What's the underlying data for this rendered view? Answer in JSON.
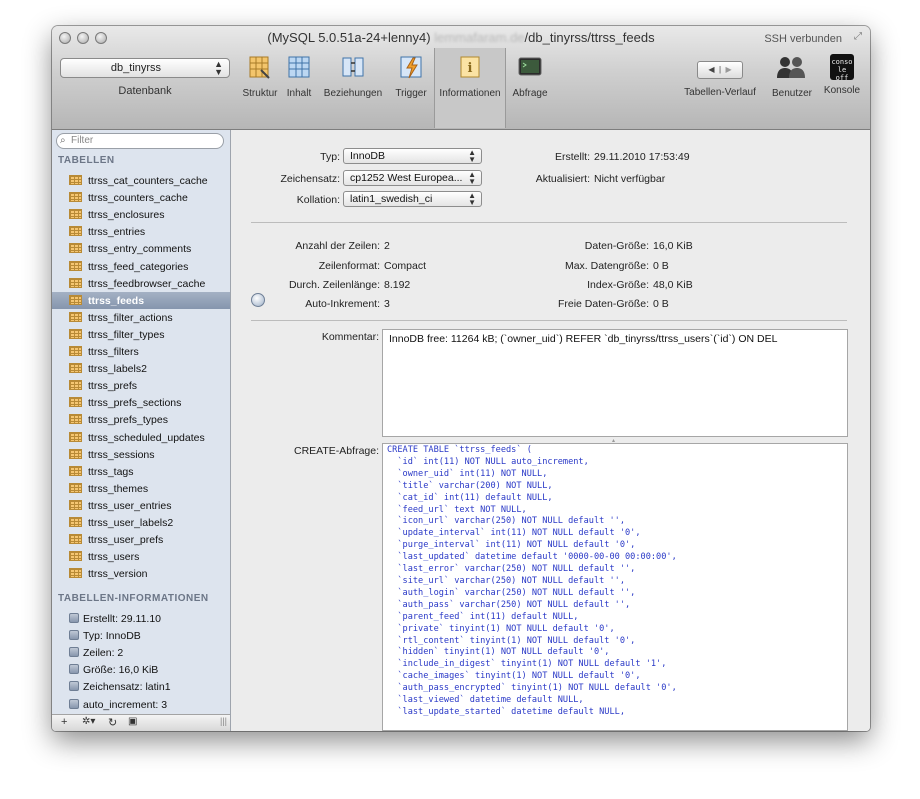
{
  "window": {
    "title_prefix": "(MySQL 5.0.51a-24+lenny4)",
    "title_blurred": "lemmafaram.de",
    "title_suffix": "/db_tinyrss/ttrss_feeds",
    "ssh_status": "SSH verbunden"
  },
  "toolbar": {
    "database_value": "db_tinyrss",
    "database_label": "Datenbank",
    "tools": [
      {
        "label": "Struktur",
        "icon": "structure-icon"
      },
      {
        "label": "Inhalt",
        "icon": "content-icon"
      },
      {
        "label": "Beziehungen",
        "icon": "relations-icon"
      },
      {
        "label": "Trigger",
        "icon": "trigger-icon"
      },
      {
        "label": "Informationen",
        "icon": "info-icon",
        "active": true
      },
      {
        "label": "Abfrage",
        "icon": "query-icon"
      }
    ],
    "history_label": "Tabellen-Verlauf",
    "users_label": "Benutzer",
    "console_label": "Konsole",
    "console_icon_text": "conso le off"
  },
  "sidebar": {
    "filter_placeholder": "Filter",
    "tables_heading": "TABELLEN",
    "tables": [
      "ttrss_cat_counters_cache",
      "ttrss_counters_cache",
      "ttrss_enclosures",
      "ttrss_entries",
      "ttrss_entry_comments",
      "ttrss_feed_categories",
      "ttrss_feedbrowser_cache",
      "ttrss_feeds",
      "ttrss_filter_actions",
      "ttrss_filter_types",
      "ttrss_filters",
      "ttrss_labels2",
      "ttrss_prefs",
      "ttrss_prefs_sections",
      "ttrss_prefs_types",
      "ttrss_scheduled_updates",
      "ttrss_sessions",
      "ttrss_tags",
      "ttrss_themes",
      "ttrss_user_entries",
      "ttrss_user_labels2",
      "ttrss_user_prefs",
      "ttrss_users",
      "ttrss_version"
    ],
    "selected_table": "ttrss_feeds",
    "info_heading": "TABELLEN-INFORMATIONEN",
    "info_items": [
      "Erstellt: 29.11.10",
      "Typ: InnoDB",
      "Zeilen: 2",
      "Größe: 16,0 KiB",
      "Zeichensatz: latin1",
      "auto_increment: 3"
    ]
  },
  "info": {
    "type_label": "Typ:",
    "type_value": "InnoDB",
    "charset_label": "Zeichensatz:",
    "charset_value": "cp1252 West Europea...",
    "collation_label": "Kollation:",
    "collation_value": "latin1_swedish_ci",
    "created_label": "Erstellt:",
    "created_value": "29.11.2010 17:53:49",
    "updated_label": "Aktualisiert:",
    "updated_value": "Nicht verfügbar",
    "rows_label": "Anzahl der Zeilen:",
    "rows_value": "2",
    "format_label": "Zeilenformat:",
    "format_value": "Compact",
    "avglen_label": "Durch. Zeilenlänge:",
    "avglen_value": "8.192",
    "autoinc_label": "Auto-Inkrement:",
    "autoinc_value": "3",
    "datasize_label": "Daten-Größe:",
    "datasize_value": "16,0 KiB",
    "maxdata_label": "Max. Datengröße:",
    "maxdata_value": "0 B",
    "indexsize_label": "Index-Größe:",
    "indexsize_value": "48,0 KiB",
    "free_label": "Freie Daten-Größe:",
    "free_value": "0 B",
    "comment_label": "Kommentar:",
    "comment_value": "InnoDB free: 11264 kB; (`owner_uid`) REFER `db_tinyrss/ttrss_users`(`id`) ON DEL",
    "create_label": "CREATE-Abfrage:",
    "create_sql": "CREATE TABLE `ttrss_feeds` (\n  `id` int(11) NOT NULL auto_increment,\n  `owner_uid` int(11) NOT NULL,\n  `title` varchar(200) NOT NULL,\n  `cat_id` int(11) default NULL,\n  `feed_url` text NOT NULL,\n  `icon_url` varchar(250) NOT NULL default '',\n  `update_interval` int(11) NOT NULL default '0',\n  `purge_interval` int(11) NOT NULL default '0',\n  `last_updated` datetime default '0000-00-00 00:00:00',\n  `last_error` varchar(250) NOT NULL default '',\n  `site_url` varchar(250) NOT NULL default '',\n  `auth_login` varchar(250) NOT NULL default '',\n  `auth_pass` varchar(250) NOT NULL default '',\n  `parent_feed` int(11) default NULL,\n  `private` tinyint(1) NOT NULL default '0',\n  `rtl_content` tinyint(1) NOT NULL default '0',\n  `hidden` tinyint(1) NOT NULL default '0',\n  `include_in_digest` tinyint(1) NOT NULL default '1',\n  `cache_images` tinyint(1) NOT NULL default '0',\n  `auth_pass_encrypted` tinyint(1) NOT NULL default '0',\n  `last_viewed` datetime default NULL,\n  `last_update_started` datetime default NULL,"
  }
}
